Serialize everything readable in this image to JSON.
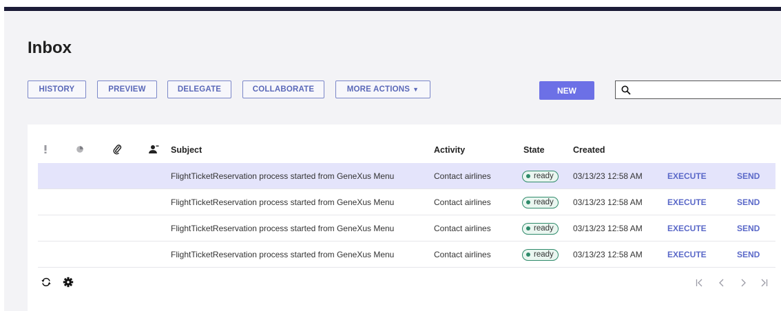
{
  "page": {
    "title": "Inbox"
  },
  "toolbar": {
    "history": "HISTORY",
    "preview": "PREVIEW",
    "delegate": "DELEGATE",
    "collaborate": "COLLABORATE",
    "more_actions": "MORE ACTIONS",
    "new": "NEW"
  },
  "search": {
    "value": "",
    "placeholder": ""
  },
  "table": {
    "columns": {
      "priority_icon": "exclamation-icon",
      "status_icon": "circle-status-icon",
      "attachment_icon": "paperclip-icon",
      "user_icon": "person-icon",
      "subject": "Subject",
      "activity": "Activity",
      "state": "State",
      "created": "Created"
    },
    "rows": [
      {
        "subject": "FlightTicketReservation process started from GeneXus Menu",
        "activity": "Contact airlines",
        "state": "ready",
        "created": "03/13/23 12:58 AM",
        "execute": "EXECUTE",
        "send": "SEND",
        "selected": true
      },
      {
        "subject": "FlightTicketReservation process started from GeneXus Menu",
        "activity": "Contact airlines",
        "state": "ready",
        "created": "03/13/23 12:58 AM",
        "execute": "EXECUTE",
        "send": "SEND",
        "selected": false
      },
      {
        "subject": "FlightTicketReservation process started from GeneXus Menu",
        "activity": "Contact airlines",
        "state": "ready",
        "created": "03/13/23 12:58 AM",
        "execute": "EXECUTE",
        "send": "SEND",
        "selected": false
      },
      {
        "subject": "FlightTicketReservation process started from GeneXus Menu",
        "activity": "Contact airlines",
        "state": "ready",
        "created": "03/13/23 12:58 AM",
        "execute": "EXECUTE",
        "send": "SEND",
        "selected": false
      }
    ]
  },
  "footer": {
    "refresh_icon": "refresh-icon",
    "settings_icon": "gear-icon",
    "pager": {
      "first": "|<",
      "prev": "<",
      "next": ">",
      "last": ">|"
    }
  },
  "colors": {
    "accent": "#6c70e6",
    "link": "#5a68c8",
    "selected_row": "#e4e4fb",
    "ready_badge": "#2e8a6a",
    "top_strip": "#1c1c38"
  }
}
